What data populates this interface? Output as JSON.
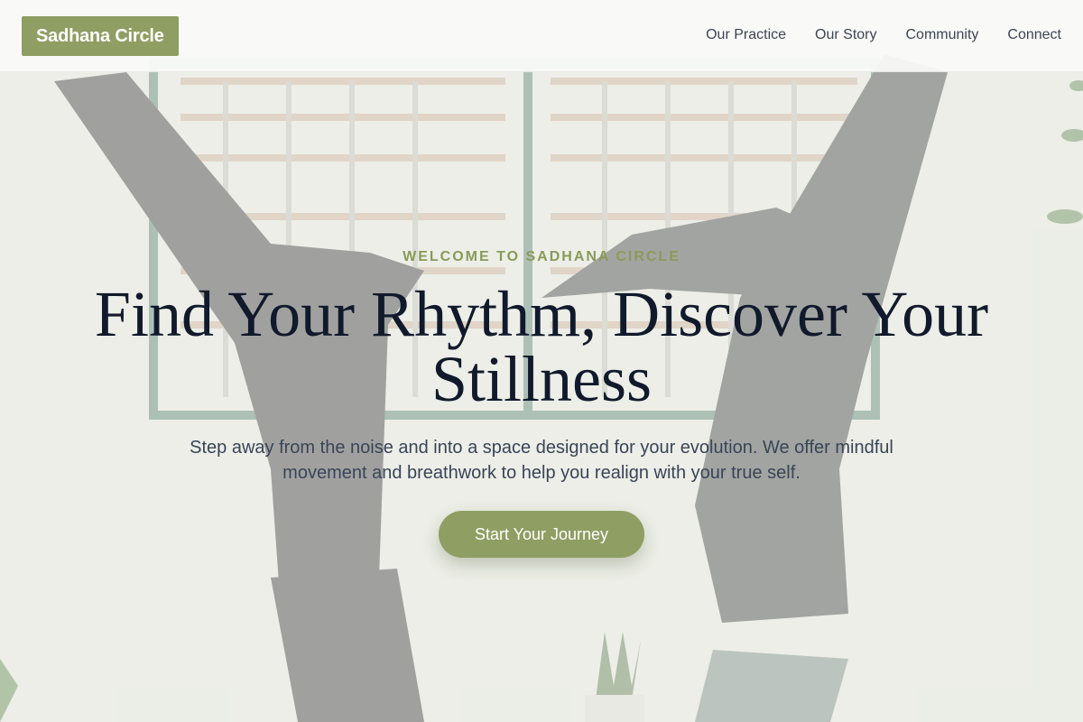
{
  "brand": {
    "logo_text": "Sadhana Circle"
  },
  "nav": {
    "items": [
      {
        "label": "Our Practice"
      },
      {
        "label": "Our Story"
      },
      {
        "label": "Community"
      },
      {
        "label": "Connect"
      }
    ]
  },
  "hero": {
    "eyebrow": "WELCOME TO SADHANA CIRCLE",
    "headline": "Find Your Rhythm, Discover Your Stillness",
    "subtext": "Step away from the noise and into a space designed for your evolution. We offer mindful movement and breathwork to help you realign with your true self.",
    "cta_label": "Start Your Journey"
  },
  "colors": {
    "accent": "#8f9e63",
    "headline": "#111a2c",
    "body_text": "#3a4458",
    "eyebrow": "#8a9a5a"
  }
}
